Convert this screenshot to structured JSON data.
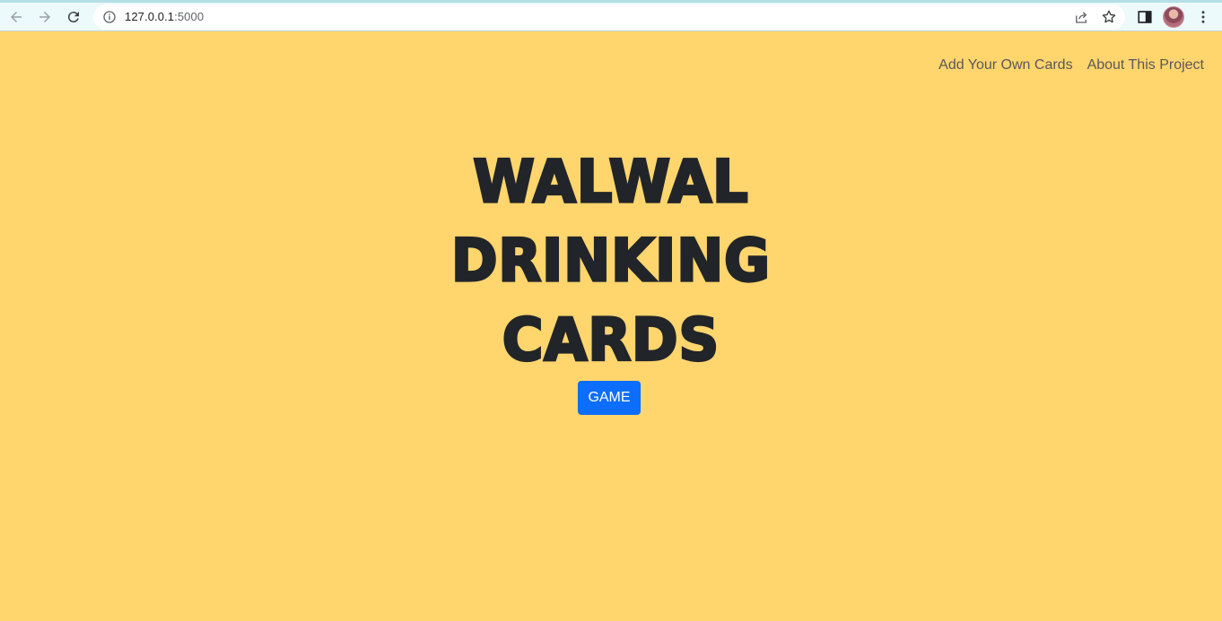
{
  "browser": {
    "url_host": "127.0.0.1",
    "url_port": ":5000"
  },
  "nav": {
    "links": [
      "Add Your Own Cards",
      "About This Project"
    ]
  },
  "hero": {
    "title_lines": [
      "WALWAL",
      "DRINKING",
      "CARDS"
    ],
    "button_label": "GAME"
  },
  "colors": {
    "background": "#ffd56d",
    "button": "#0d6efd",
    "title": "#212529",
    "nav_text": "#595959"
  },
  "icons": [
    "back-icon",
    "forward-icon",
    "reload-icon",
    "info-icon",
    "share-icon",
    "star-icon",
    "side-panel-icon",
    "avatar",
    "menu-icon"
  ]
}
